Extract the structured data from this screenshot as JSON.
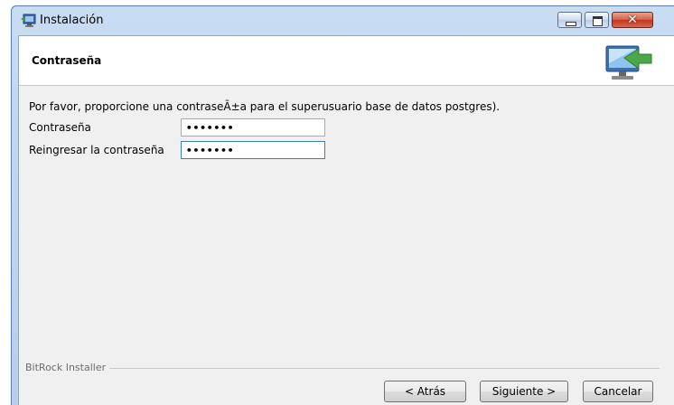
{
  "window": {
    "title": "Instalación",
    "icon": "installer-icon",
    "controls": [
      "minimize-icon",
      "maximize-icon",
      "close-icon"
    ]
  },
  "header": {
    "title": "Contraseña",
    "graphic": "monitor-arrow-icon"
  },
  "main": {
    "prompt": "Por favor, proporcione una contraseÃ±a para el superusuario base de datos postgres).",
    "password_label": "Contraseña",
    "password_value": "•••••••",
    "confirm_label": "Reingresar la contraseña",
    "confirm_value": "•••••••"
  },
  "footer": {
    "brand": "BitRock Installer",
    "back_label": "< Atrás",
    "next_label": "Siguiente >",
    "cancel_label": "Cancelar"
  },
  "colors": {
    "title_bar": "#b7cfe9",
    "panel": "#f0f0f0",
    "close_button": "#c0371b",
    "focus_border": "#3c7fb1"
  }
}
